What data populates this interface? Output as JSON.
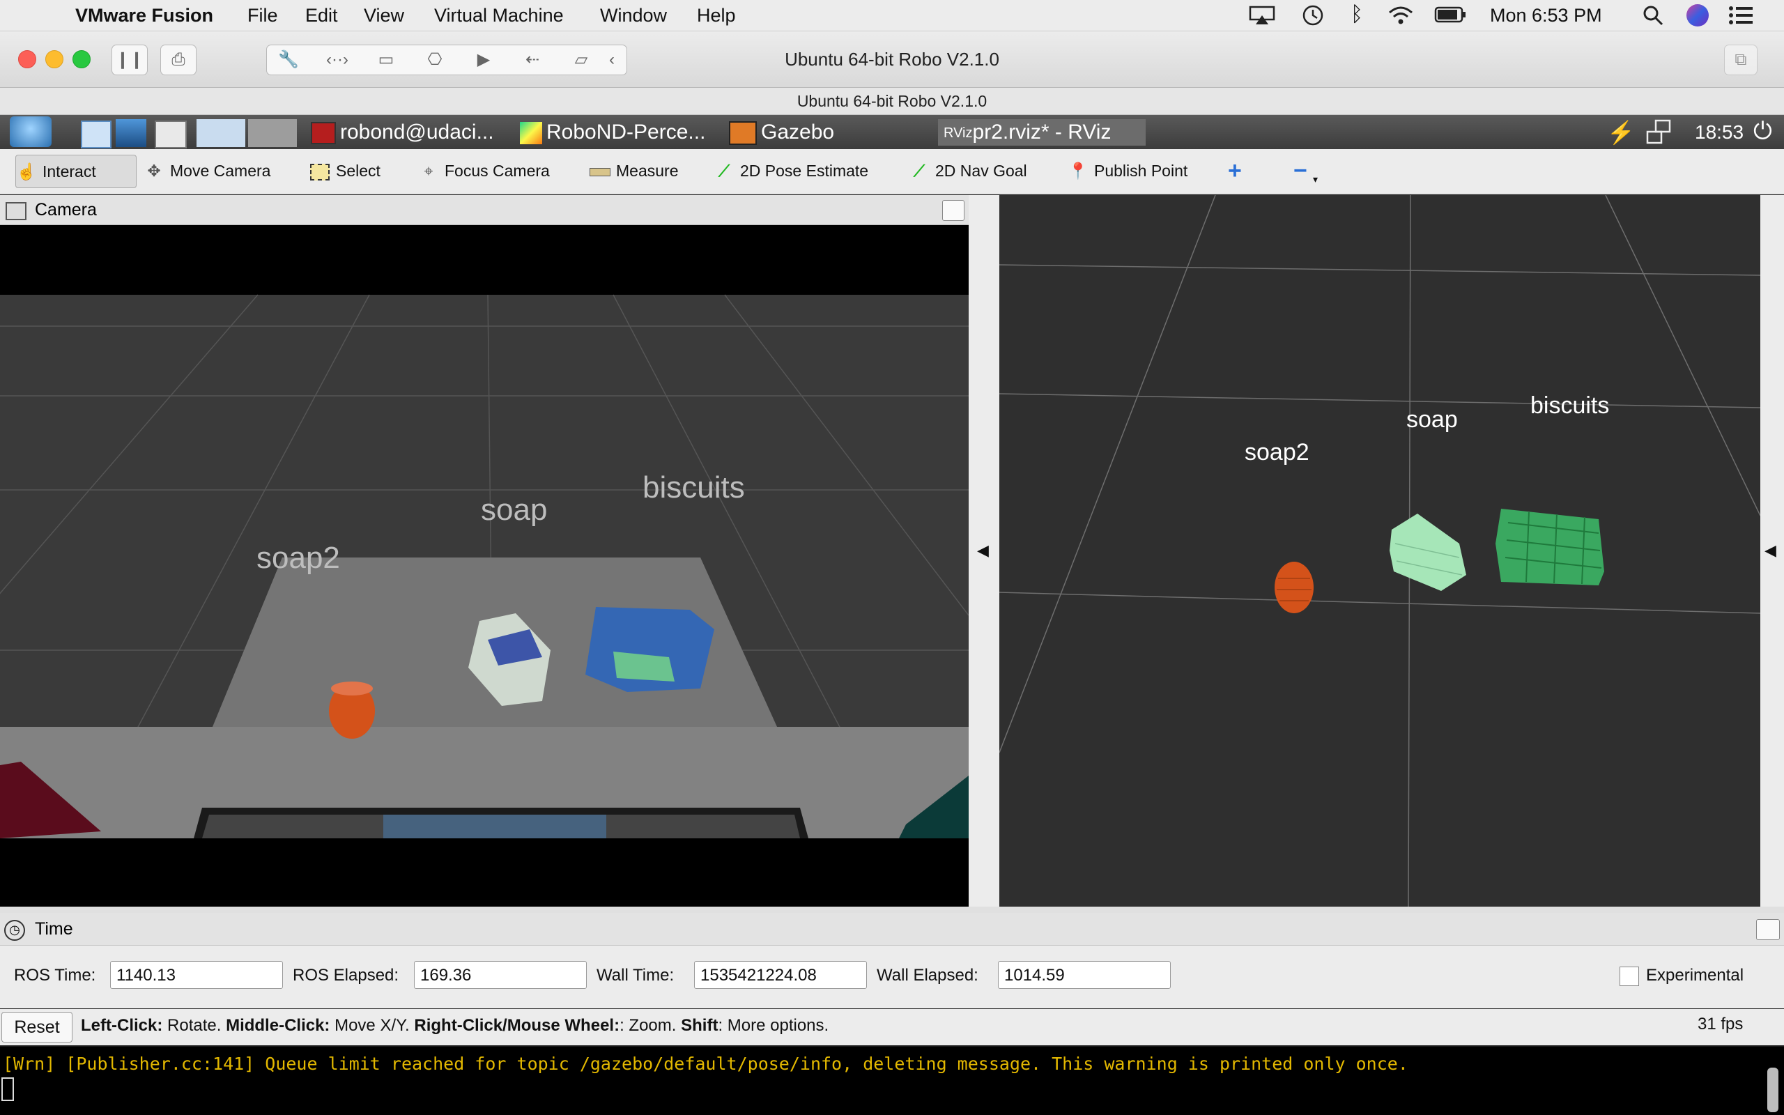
{
  "menubar": {
    "app_name": "VMware Fusion",
    "menus": [
      "File",
      "Edit",
      "View",
      "Virtual Machine",
      "Window",
      "Help"
    ],
    "clock": "Mon 6:53 PM"
  },
  "vmware": {
    "window_title": "Ubuntu 64-bit Robo V2.1.0",
    "subtitle": "Ubuntu 64-bit Robo V2.1.0"
  },
  "ubuntu_panel": {
    "tasks": [
      {
        "label": "robond@udaci..."
      },
      {
        "label": "RoboND-Perce..."
      },
      {
        "label": "Gazebo"
      },
      {
        "label": "pr2.rviz* - RViz"
      }
    ],
    "clock": "18:53"
  },
  "toolbar": {
    "tools": [
      {
        "label": "Interact",
        "icon": "hand-icon"
      },
      {
        "label": "Move Camera",
        "icon": "move-camera-icon"
      },
      {
        "label": "Select",
        "icon": "select-icon"
      },
      {
        "label": "Focus Camera",
        "icon": "focus-camera-icon"
      },
      {
        "label": "Measure",
        "icon": "ruler-icon"
      },
      {
        "label": "2D Pose Estimate",
        "icon": "pose-arrow-icon"
      },
      {
        "label": "2D Nav Goal",
        "icon": "nav-arrow-icon"
      },
      {
        "label": "Publish Point",
        "icon": "map-pin-icon"
      }
    ]
  },
  "camera_panel": {
    "title": "Camera",
    "labels": {
      "soap2": "soap2",
      "soap": "soap",
      "biscuits": "biscuits"
    }
  },
  "view3d": {
    "labels": {
      "soap2": "soap2",
      "soap": "soap",
      "biscuits": "biscuits"
    }
  },
  "time_panel": {
    "title": "Time",
    "ros_time_label": "ROS Time:",
    "ros_time": "1140.13",
    "ros_elapsed_label": "ROS Elapsed:",
    "ros_elapsed": "169.36",
    "wall_time_label": "Wall Time:",
    "wall_time": "1535421224.08",
    "wall_elapsed_label": "Wall Elapsed:",
    "wall_elapsed": "1014.59",
    "experimental_label": "Experimental"
  },
  "status": {
    "reset_label": "Reset",
    "left_click_key": "Left-Click:",
    "left_click_text": "Rotate.",
    "middle_click_key": "Middle-Click:",
    "middle_click_text": "Move X/Y.",
    "right_click_key": "Right-Click/Mouse Wheel:",
    "right_click_text": ": Zoom.",
    "shift_key": "Shift",
    "shift_text": ": More options.",
    "fps": "31 fps"
  },
  "terminal": {
    "line": "[Wrn] [Publisher.cc:141] Queue limit reached for topic /gazebo/default/pose/info, deleting message. This warning is printed only once."
  },
  "colors": {
    "warning_text": "#e3b800",
    "soap2_cloud": "#d4521a",
    "soap_cloud": "#a6e6b8",
    "biscuits_cloud": "#3aa860"
  }
}
